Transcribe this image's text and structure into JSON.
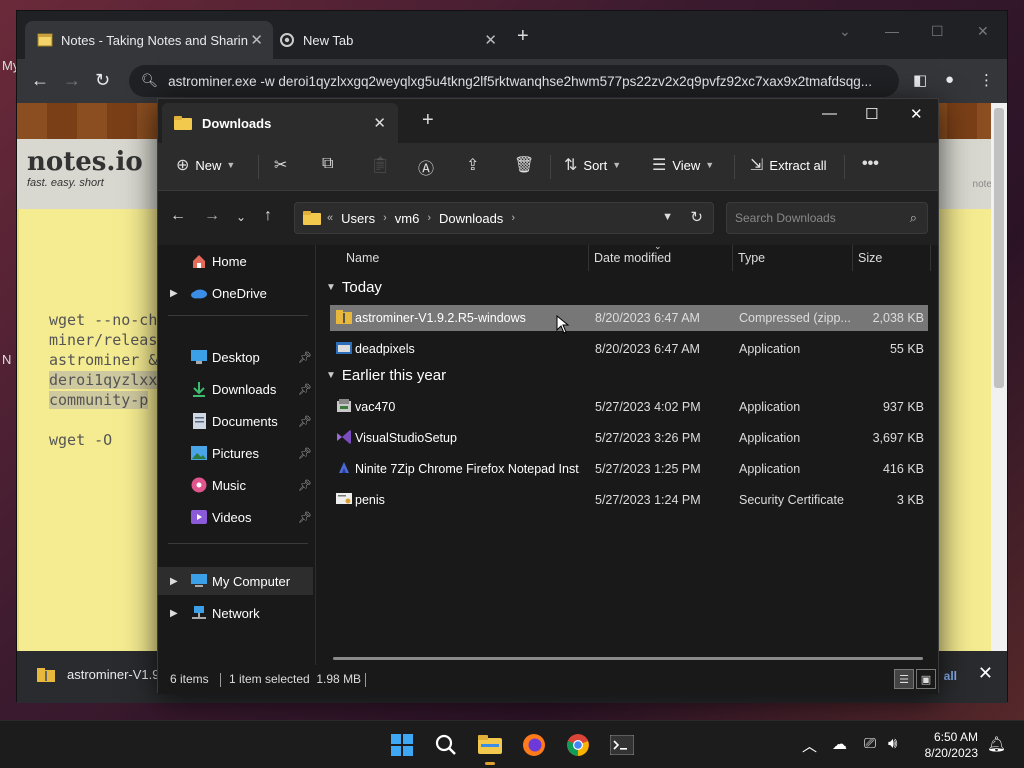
{
  "desktop": {
    "edge_letters": [
      "My",
      "N"
    ]
  },
  "browser": {
    "tabs": [
      {
        "title": "Notes - Taking Notes and Sharin",
        "active": true
      },
      {
        "title": "New Tab",
        "active": false
      }
    ],
    "address": "astrominer.exe -w deroi1qyzlxxgq2weyqlxg5u4tkng2lf5rktwanqhse2hwm577ps22zv2x2q9pvfz92xc7xax9x2tmafdsqg...",
    "page": {
      "logo_main": "notes.io",
      "logo_tagline": "fast. easy. short",
      "right_label": "notes",
      "note_lines": [
        "wget --no-ch",
        "miner/release",
        "astrominer &&",
        "deroi1qyzlxxg",
        "community-p",
        "wget -O"
      ]
    },
    "download_bar": {
      "file": "astrominer-V1.9",
      "show_all": "all"
    }
  },
  "explorer": {
    "tab_title": "Downloads",
    "toolbar": {
      "new_label": "New",
      "sort_label": "Sort",
      "view_label": "View",
      "extract_label": "Extract all"
    },
    "breadcrumb": [
      "Users",
      "vm6",
      "Downloads"
    ],
    "search_placeholder": "Search Downloads",
    "nav": {
      "home": "Home",
      "onedrive": "OneDrive",
      "desktop": "Desktop",
      "downloads": "Downloads",
      "documents": "Documents",
      "pictures": "Pictures",
      "music": "Music",
      "videos": "Videos",
      "my_computer": "My Computer",
      "network": "Network"
    },
    "columns": {
      "name": "Name",
      "date": "Date modified",
      "type": "Type",
      "size": "Size"
    },
    "groups": {
      "today": {
        "label": "Today",
        "files": [
          {
            "name": "astrominer-V1.9.2.R5-windows",
            "date": "8/20/2023 6:47 AM",
            "type": "Compressed (zipp...",
            "size": "2,038 KB",
            "icon": "zip-folder-icon"
          },
          {
            "name": "deadpixels",
            "date": "8/20/2023 6:47 AM",
            "type": "Application",
            "size": "55 KB",
            "icon": "app-icon"
          }
        ]
      },
      "earlier": {
        "label": "Earlier this year",
        "files": [
          {
            "name": "vac470",
            "date": "5/27/2023 4:02 PM",
            "type": "Application",
            "size": "937 KB",
            "icon": "installer-icon"
          },
          {
            "name": "VisualStudioSetup",
            "date": "5/27/2023 3:26 PM",
            "type": "Application",
            "size": "3,697 KB",
            "icon": "visual-studio-icon"
          },
          {
            "name": "Ninite 7Zip Chrome Firefox Notepad Inst...",
            "date": "5/27/2023 1:25 PM",
            "type": "Application",
            "size": "416 KB",
            "icon": "ninite-icon"
          },
          {
            "name": "penis",
            "date": "5/27/2023 1:24 PM",
            "type": "Security Certificate",
            "size": "3 KB",
            "icon": "certificate-icon"
          }
        ]
      }
    },
    "status": {
      "count": "6 items",
      "selection": "1 item selected  1.98 MB"
    }
  },
  "taskbar": {
    "time": "6:50 AM",
    "date": "8/20/2023"
  },
  "colors": {
    "explorer_bg": "#191919",
    "selected_row": "#777777",
    "note_paper": "#f5eb91"
  }
}
